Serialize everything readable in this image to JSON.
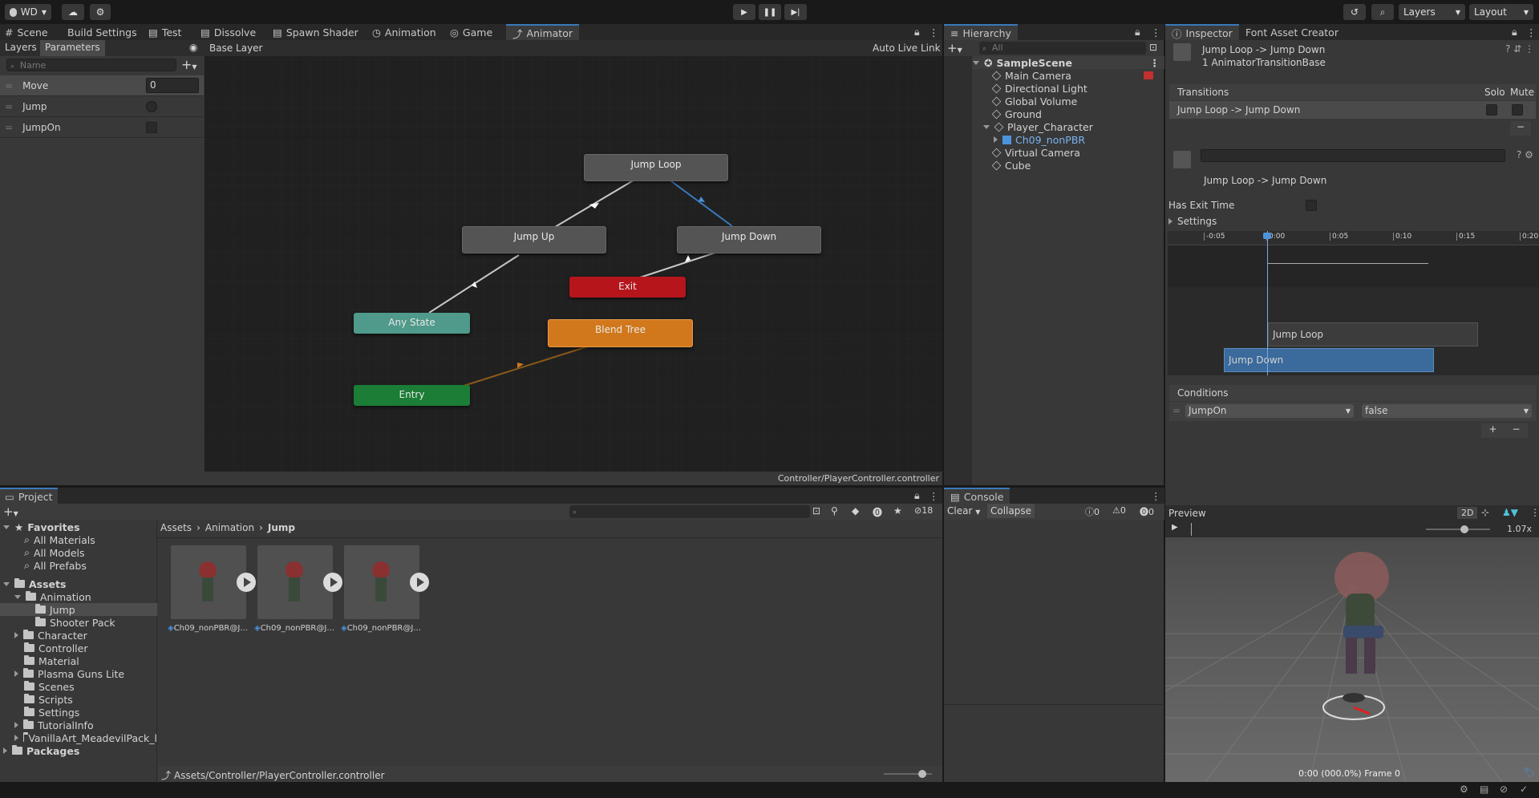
{
  "toolbar": {
    "account": "WD",
    "layers": "Layers",
    "layout": "Layout"
  },
  "tabs_left": [
    {
      "label": "Scene"
    },
    {
      "label": "Build Settings"
    },
    {
      "label": "Test"
    },
    {
      "label": "Dissolve"
    },
    {
      "label": "Spawn Shader"
    },
    {
      "label": "Animation"
    },
    {
      "label": "Game"
    },
    {
      "label": "Animator"
    }
  ],
  "animator": {
    "subtabs": {
      "layers": "Layers",
      "parameters": "Parameters"
    },
    "layer_name": "Base Layer",
    "auto_live_link": "Auto Live Link",
    "search_placeholder": "Name",
    "parameters": [
      {
        "name": "Move",
        "value": "0"
      },
      {
        "name": "Jump"
      },
      {
        "name": "JumpOn"
      }
    ],
    "nodes": {
      "jump_loop": "Jump Loop",
      "jump_up": "Jump Up",
      "jump_down": "Jump Down",
      "exit": "Exit",
      "any_state": "Any State",
      "blend_tree": "Blend Tree",
      "entry": "Entry"
    },
    "path": "Controller/PlayerController.controller"
  },
  "hierarchy": {
    "title": "Hierarchy",
    "search_placeholder": "All",
    "scene": "SampleScene",
    "items": [
      "Main Camera",
      "Directional Light",
      "Global Volume",
      "Ground",
      "Player_Character",
      "Ch09_nonPBR",
      "Virtual Camera",
      "Cube"
    ]
  },
  "inspector": {
    "tab": "Inspector",
    "tab2": "Font Asset Creator",
    "title": "Jump Loop -> Jump Down",
    "subtitle": "1 AnimatorTransitionBase",
    "transitions_header": "Transitions",
    "solo": "Solo",
    "mute": "Mute",
    "transition_row": "Jump Loop -> Jump Down",
    "transition_name": "Jump Loop -> Jump Down",
    "has_exit_time": "Has Exit Time",
    "settings": "Settings",
    "timeline_ticks": [
      "-0:05",
      "0:00",
      "0:05",
      "0:10",
      "0:15",
      "0:20"
    ],
    "bar_jump_loop": "Jump Loop",
    "bar_jump_down": "Jump Down",
    "conditions_header": "Conditions",
    "condition_param": "JumpOn",
    "condition_value": "false",
    "preview_label": "Preview",
    "preview_2d": "2D",
    "preview_speed": "1.07x",
    "preview_frame": "0:00 (000.0%) Frame 0"
  },
  "project": {
    "title": "Project",
    "hidden_count": "18",
    "favorites": "Favorites",
    "fav_items": [
      "All Materials",
      "All Models",
      "All Prefabs"
    ],
    "assets": "Assets",
    "tree": [
      "Animation",
      "Jump",
      "Shooter Pack",
      "Character",
      "Controller",
      "Material",
      "Plasma Guns Lite",
      "Scenes",
      "Scripts",
      "Settings",
      "TutorialInfo",
      "VanillaArt_MeadevilPack_l"
    ],
    "packages": "Packages",
    "breadcrumb": [
      "Assets",
      "Animation",
      "Jump"
    ],
    "files": [
      "Ch09_nonPBR@J...",
      "Ch09_nonPBR@J...",
      "Ch09_nonPBR@J..."
    ],
    "footer_path": "Assets/Controller/PlayerController.controller"
  },
  "console": {
    "title": "Console",
    "clear": "Clear",
    "collapse": "Collapse",
    "counts": [
      "0",
      "0",
      "0"
    ]
  },
  "colors": {
    "accent": "#3a79bb",
    "exit": "#b5151b",
    "any_state": "#4f9a8a",
    "blend_tree": "#d2781c",
    "entry": "#1b7d36",
    "node": "#545454"
  }
}
